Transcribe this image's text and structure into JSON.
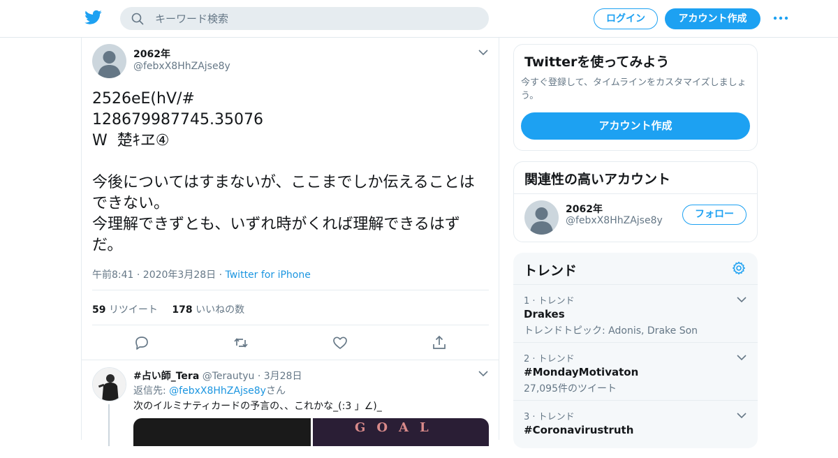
{
  "header": {
    "search_placeholder": "キーワード検索",
    "login_label": "ログイン",
    "signup_label": "アカウント作成"
  },
  "tweet": {
    "name": "2062年",
    "handle": "@febxX8HhZAjse8y",
    "text": "2526eE(hV/#\n128679987745.35076\nW  楚ｷヱ④\n\n今後についてはすまないが、ここまでしか伝えることはできない。\n今理解できずとも、いずれ時がくれば理解できるはずだ。",
    "time": "午前8:41 · 2020年3月28日 · ",
    "source": "Twitter for iPhone",
    "retweet_count": "59",
    "retweet_label": "リツイート",
    "like_count": "178",
    "like_label": "いいねの数"
  },
  "reply": {
    "name": "#占い師_Tera",
    "handle": "@Terautyu",
    "date": " · 3月28日",
    "reply_to_prefix": "返信先: ",
    "reply_to_handle": "@febxX8HhZAjse8y",
    "reply_to_suffix": "さん",
    "text": "次のイルミナティカードの予言の、、これかな_(:3 」∠)_",
    "image_text": "GOAL"
  },
  "signup_card": {
    "title": "Twitterを使ってみよう",
    "desc": "今すぐ登録して、タイムラインをカスタマイズしましょう。",
    "button": "アカウント作成"
  },
  "related_card": {
    "title": "関連性の高いアカウント",
    "name": "2062年",
    "handle": "@febxX8HhZAjse8y",
    "follow": "フォロー"
  },
  "trends": {
    "title": "トレンド",
    "items": [
      {
        "meta": "1 · トレンド",
        "title": "Drakes",
        "sub": "トレンドトピック: Adonis, Drake Son"
      },
      {
        "meta": "2 · トレンド",
        "title": "#MondayMotivaton",
        "sub": "27,095件のツイート"
      },
      {
        "meta": "3 · トレンド",
        "title": "#Coronavirustruth",
        "sub": ""
      }
    ]
  },
  "colors": {
    "accent": "#1da1f2",
    "link": "#1b95e0",
    "muted": "#657786"
  }
}
